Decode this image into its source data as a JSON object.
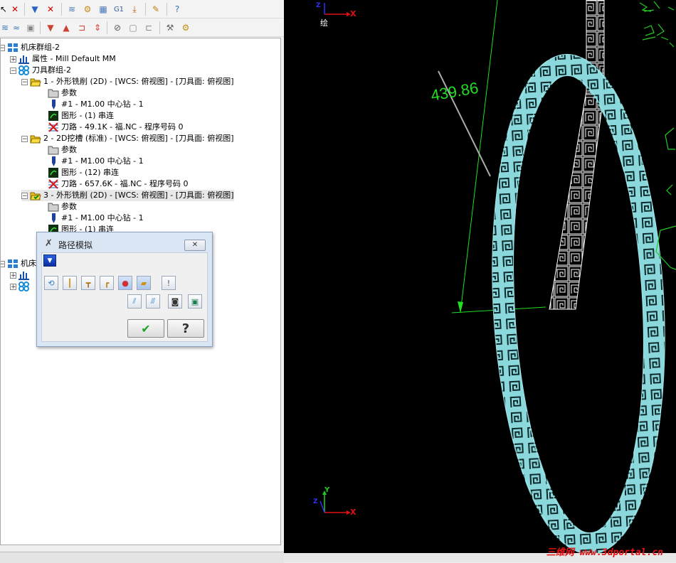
{
  "tree": {
    "root1": "机床群组-2",
    "props": "属性 - Mill Default MM",
    "toolgroup": "刀具群组-2",
    "op1": {
      "title": "1 - 外形铣削 (2D) - [WCS: 俯视图] - [刀具面: 俯视图]",
      "params": "参数",
      "tool": "#1 - M1.00 中心钻 - 1",
      "geom": "图形 - (1) 串连",
      "path": "刀路 - 49.1K - 福.NC - 程序号码 0"
    },
    "op2": {
      "title": "2 - 2D挖槽 (标准) - [WCS: 俯视图] - [刀具面: 俯视图]",
      "params": "参数",
      "tool": "#1 - M1.00 中心钻 - 1",
      "geom": "图形 - (12) 串连",
      "path": "刀路 - 657.6K - 福.NC - 程序号码 0"
    },
    "op3": {
      "title": "3 - 外形铣削 (2D) - [WCS: 俯视图] - [刀具面: 俯视图]",
      "params": "参数",
      "tool": "#1 - M1.00 中心钻 - 1",
      "geom": "图形 - (1) 串连"
    },
    "root2": "机床"
  },
  "dialog": {
    "title": "路径模拟",
    "close": "✕",
    "ok": "✔",
    "help": "?"
  },
  "viewport": {
    "dimension": "439.86",
    "view_label": "绘",
    "axis_x": "X",
    "axis_y": "Y",
    "axis_z": "Z"
  },
  "watermark": "三维网 www.3dportal.cn",
  "colors": {
    "ring": "#7fe0e6",
    "dimension": "#22dd22",
    "axis_x": "#e01010",
    "axis_y": "#22cc22",
    "axis_z": "#3030ff"
  }
}
